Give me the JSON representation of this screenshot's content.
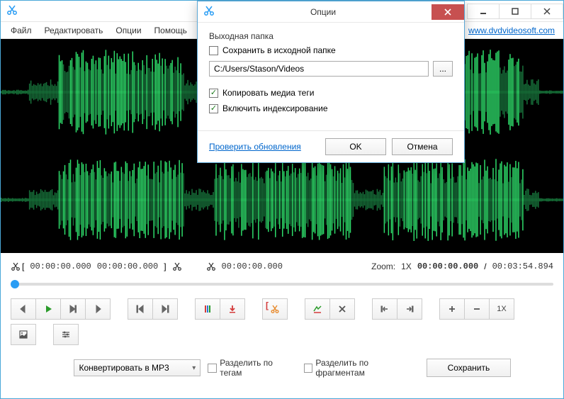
{
  "menubar": {
    "file": "Файл",
    "edit": "Редактировать",
    "options": "Опции",
    "help": "Помощь",
    "link": "www.dvdvideosoft.com"
  },
  "timebar": {
    "sel_start": "00:00:00.000",
    "sel_end": "00:00:00.000",
    "cursor": "00:00:00.000",
    "zoom_label": "Zoom:",
    "zoom_value": "1X",
    "position": "00:00:00.000",
    "separator": "/",
    "duration": "00:03:54.894"
  },
  "toolbar": {
    "reset_zoom_label": "1X"
  },
  "bottom": {
    "format": "Конвертировать в MP3",
    "split_tags": "Разделить по тегам",
    "split_fragments": "Разделить по фрагментам",
    "save": "Сохранить"
  },
  "dialog": {
    "title": "Опции",
    "section_output": "Выходная папка",
    "save_in_source": "Сохранить в исходной папке",
    "path": "C:/Users/Stason/Videos",
    "browse": "...",
    "copy_tags": "Копировать медиа теги",
    "enable_indexing": "Включить индексирование",
    "check_updates": "Проверить обновления",
    "ok": "OK",
    "cancel": "Отмена"
  }
}
